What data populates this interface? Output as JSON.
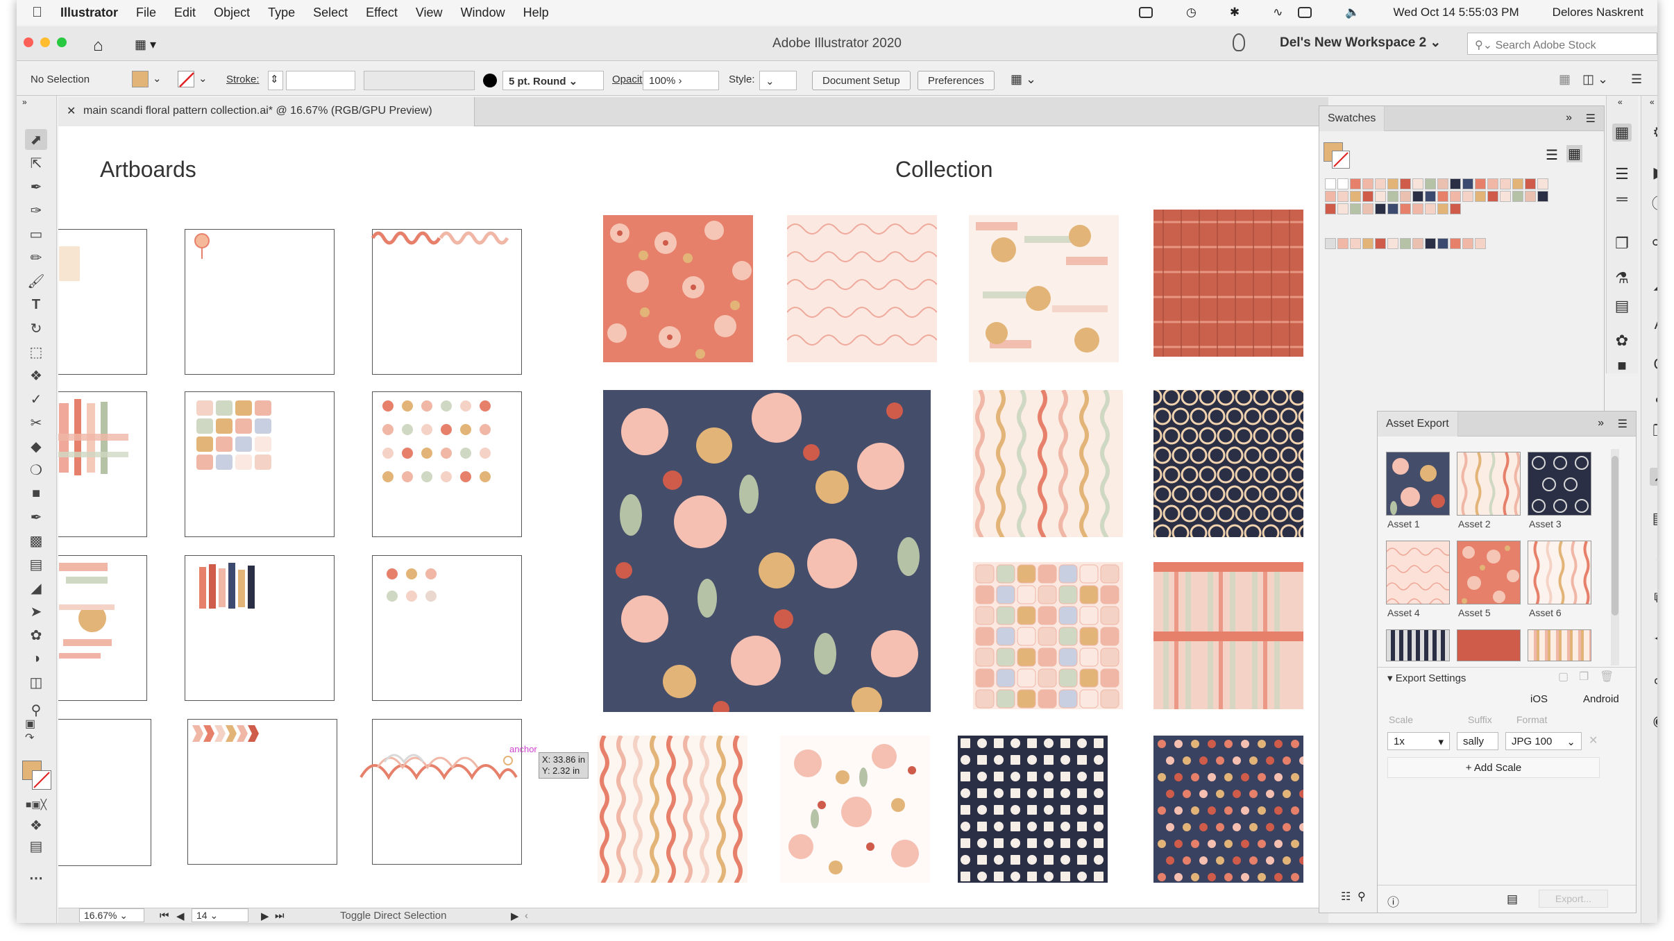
{
  "menubar": {
    "apple": "",
    "items": [
      "Illustrator",
      "File",
      "Edit",
      "Object",
      "Type",
      "Select",
      "Effect",
      "View",
      "Window",
      "Help"
    ],
    "datetime": "Wed Oct 14  5:55:03 PM",
    "user": "Delores Naskrent"
  },
  "titlebar": {
    "title": "Adobe Illustrator 2020",
    "workspace": "Del's New Workspace 2",
    "search_placeholder": "Search Adobe Stock"
  },
  "control": {
    "selection": "No Selection",
    "stroke_label": "Stroke:",
    "brush": "5 pt. Round",
    "opacity_label": "Opacity:",
    "opacity_value": "100%",
    "style_label": "Style:",
    "doc_setup": "Document Setup",
    "preferences": "Preferences",
    "fill_color": "#e3b477"
  },
  "document": {
    "tab_title": "main scandi floral pattern collection.ai* @ 16.67% (RGB/GPU Preview)"
  },
  "canvas": {
    "artboards_heading": "Artboards",
    "collection_heading": "Collection",
    "tooltip_x": "X: 33.86 in",
    "tooltip_y": "Y: 2.32 in",
    "anchor_label": "anchor"
  },
  "status": {
    "zoom": "16.67%",
    "artboard": "14",
    "tool_hint": "Toggle Direct Selection"
  },
  "swatches_panel": {
    "title": "Swatches",
    "colors": [
      "#2b2f45",
      "#3d4a70",
      "#e7806b",
      "#f0b6a6",
      "#f5d2c6",
      "#e3b477",
      "#cf5b4b",
      "#f7e3d9",
      "#b6c2a5",
      "#eac0b1"
    ]
  },
  "asset_export": {
    "title": "Asset Export",
    "assets": [
      "Asset 1",
      "Asset 2",
      "Asset 3",
      "Asset 4",
      "Asset 5",
      "Asset 6"
    ],
    "export_settings": "Export Settings",
    "ios": "iOS",
    "android": "Android",
    "scale_label": "Scale",
    "suffix_label": "Suffix",
    "format_label": "Format",
    "scale_value": "1x",
    "suffix_value": "sally",
    "format_value": "JPG 100",
    "add_scale": "Add Scale",
    "export_button": "Export..."
  }
}
